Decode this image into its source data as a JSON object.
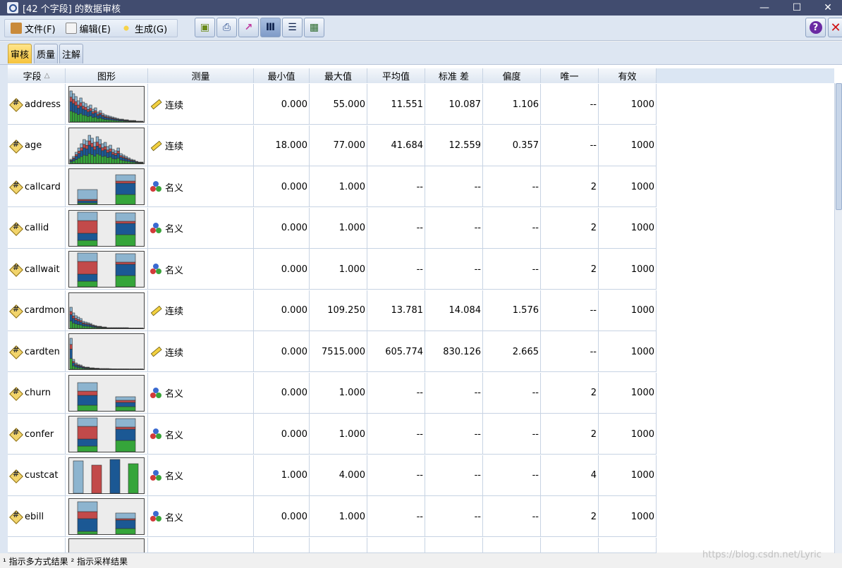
{
  "window": {
    "title": "[42 个字段] 的数据审核",
    "minimize": "—",
    "maximize": "☐",
    "close": "✕"
  },
  "menu": [
    {
      "label": "文件(F)",
      "icon": "file-box-icon"
    },
    {
      "label": "编辑(E)",
      "icon": "edit-note-icon"
    },
    {
      "label": "生成(G)",
      "icon": "generate-wand-icon"
    }
  ],
  "toolbar": [
    {
      "name": "generate-node-icon",
      "glyph": "▣"
    },
    {
      "name": "print-icon",
      "glyph": "⎙"
    },
    {
      "name": "chart-icon",
      "glyph": "📈"
    },
    {
      "name": "columns-view-icon",
      "glyph": "Ⅲ",
      "active": true
    },
    {
      "name": "rows-view-icon",
      "glyph": "☰"
    },
    {
      "name": "table-icon",
      "glyph": "▦"
    }
  ],
  "help": "?",
  "close_x": "✕",
  "tabs": [
    "审核",
    "质量",
    "注解"
  ],
  "columns": [
    "字段",
    "图形",
    "测量",
    "最小值",
    "最大值",
    "平均值",
    "标准 差",
    "偏度",
    "唯一",
    "有效"
  ],
  "sort_indicator": "△",
  "rows": [
    {
      "field": "address",
      "graph": "histogram-skew",
      "measure": "连续",
      "measure_type": "continuous",
      "min": "0.000",
      "max": "55.000",
      "mean": "11.551",
      "std": "10.087",
      "skew": "1.106",
      "unique": "--",
      "valid": "1000"
    },
    {
      "field": "age",
      "graph": "histogram-normal",
      "measure": "连续",
      "measure_type": "continuous",
      "min": "18.000",
      "max": "77.000",
      "mean": "41.684",
      "std": "12.559",
      "skew": "0.357",
      "unique": "--",
      "valid": "1000"
    },
    {
      "field": "callcard",
      "graph": "bar2-small-large",
      "measure": "名义",
      "measure_type": "nominal",
      "min": "0.000",
      "max": "1.000",
      "mean": "--",
      "std": "--",
      "skew": "--",
      "unique": "2",
      "valid": "1000"
    },
    {
      "field": "callid",
      "graph": "bar2-equal",
      "measure": "名义",
      "measure_type": "nominal",
      "min": "0.000",
      "max": "1.000",
      "mean": "--",
      "std": "--",
      "skew": "--",
      "unique": "2",
      "valid": "1000"
    },
    {
      "field": "callwait",
      "graph": "bar2-equal",
      "measure": "名义",
      "measure_type": "nominal",
      "min": "0.000",
      "max": "1.000",
      "mean": "--",
      "std": "--",
      "skew": "--",
      "unique": "2",
      "valid": "1000"
    },
    {
      "field": "cardmon",
      "graph": "histogram-steep",
      "measure": "连续",
      "measure_type": "continuous",
      "min": "0.000",
      "max": "109.250",
      "mean": "13.781",
      "std": "14.084",
      "skew": "1.576",
      "unique": "--",
      "valid": "1000"
    },
    {
      "field": "cardten",
      "graph": "histogram-steep2",
      "measure": "连续",
      "measure_type": "continuous",
      "min": "0.000",
      "max": "7515.000",
      "mean": "605.774",
      "std": "830.126",
      "skew": "2.665",
      "unique": "--",
      "valid": "1000"
    },
    {
      "field": "churn",
      "graph": "bar2-large-small",
      "measure": "名义",
      "measure_type": "nominal",
      "min": "0.000",
      "max": "1.000",
      "mean": "--",
      "std": "--",
      "skew": "--",
      "unique": "2",
      "valid": "1000"
    },
    {
      "field": "confer",
      "graph": "bar2-equal",
      "measure": "名义",
      "measure_type": "nominal",
      "min": "0.000",
      "max": "1.000",
      "mean": "--",
      "std": "--",
      "skew": "--",
      "unique": "2",
      "valid": "1000"
    },
    {
      "field": "custcat",
      "graph": "bar4",
      "measure": "名义",
      "measure_type": "nominal",
      "min": "1.000",
      "max": "4.000",
      "mean": "--",
      "std": "--",
      "skew": "--",
      "unique": "4",
      "valid": "1000"
    },
    {
      "field": "ebill",
      "graph": "bar2-large-small2",
      "measure": "名义",
      "measure_type": "nominal",
      "min": "0.000",
      "max": "1.000",
      "mean": "--",
      "std": "--",
      "skew": "--",
      "unique": "2",
      "valid": "1000"
    }
  ],
  "footer": "¹ 指示多方式结果   ² 指示采样结果",
  "watermark": "https://blog.csdn.net/Lyric",
  "colors": {
    "blue_light": "#8db4cf",
    "red": "#c24a4a",
    "blue_dark": "#1b5894",
    "green": "#35a53a",
    "title_bg": "#414c6f"
  }
}
